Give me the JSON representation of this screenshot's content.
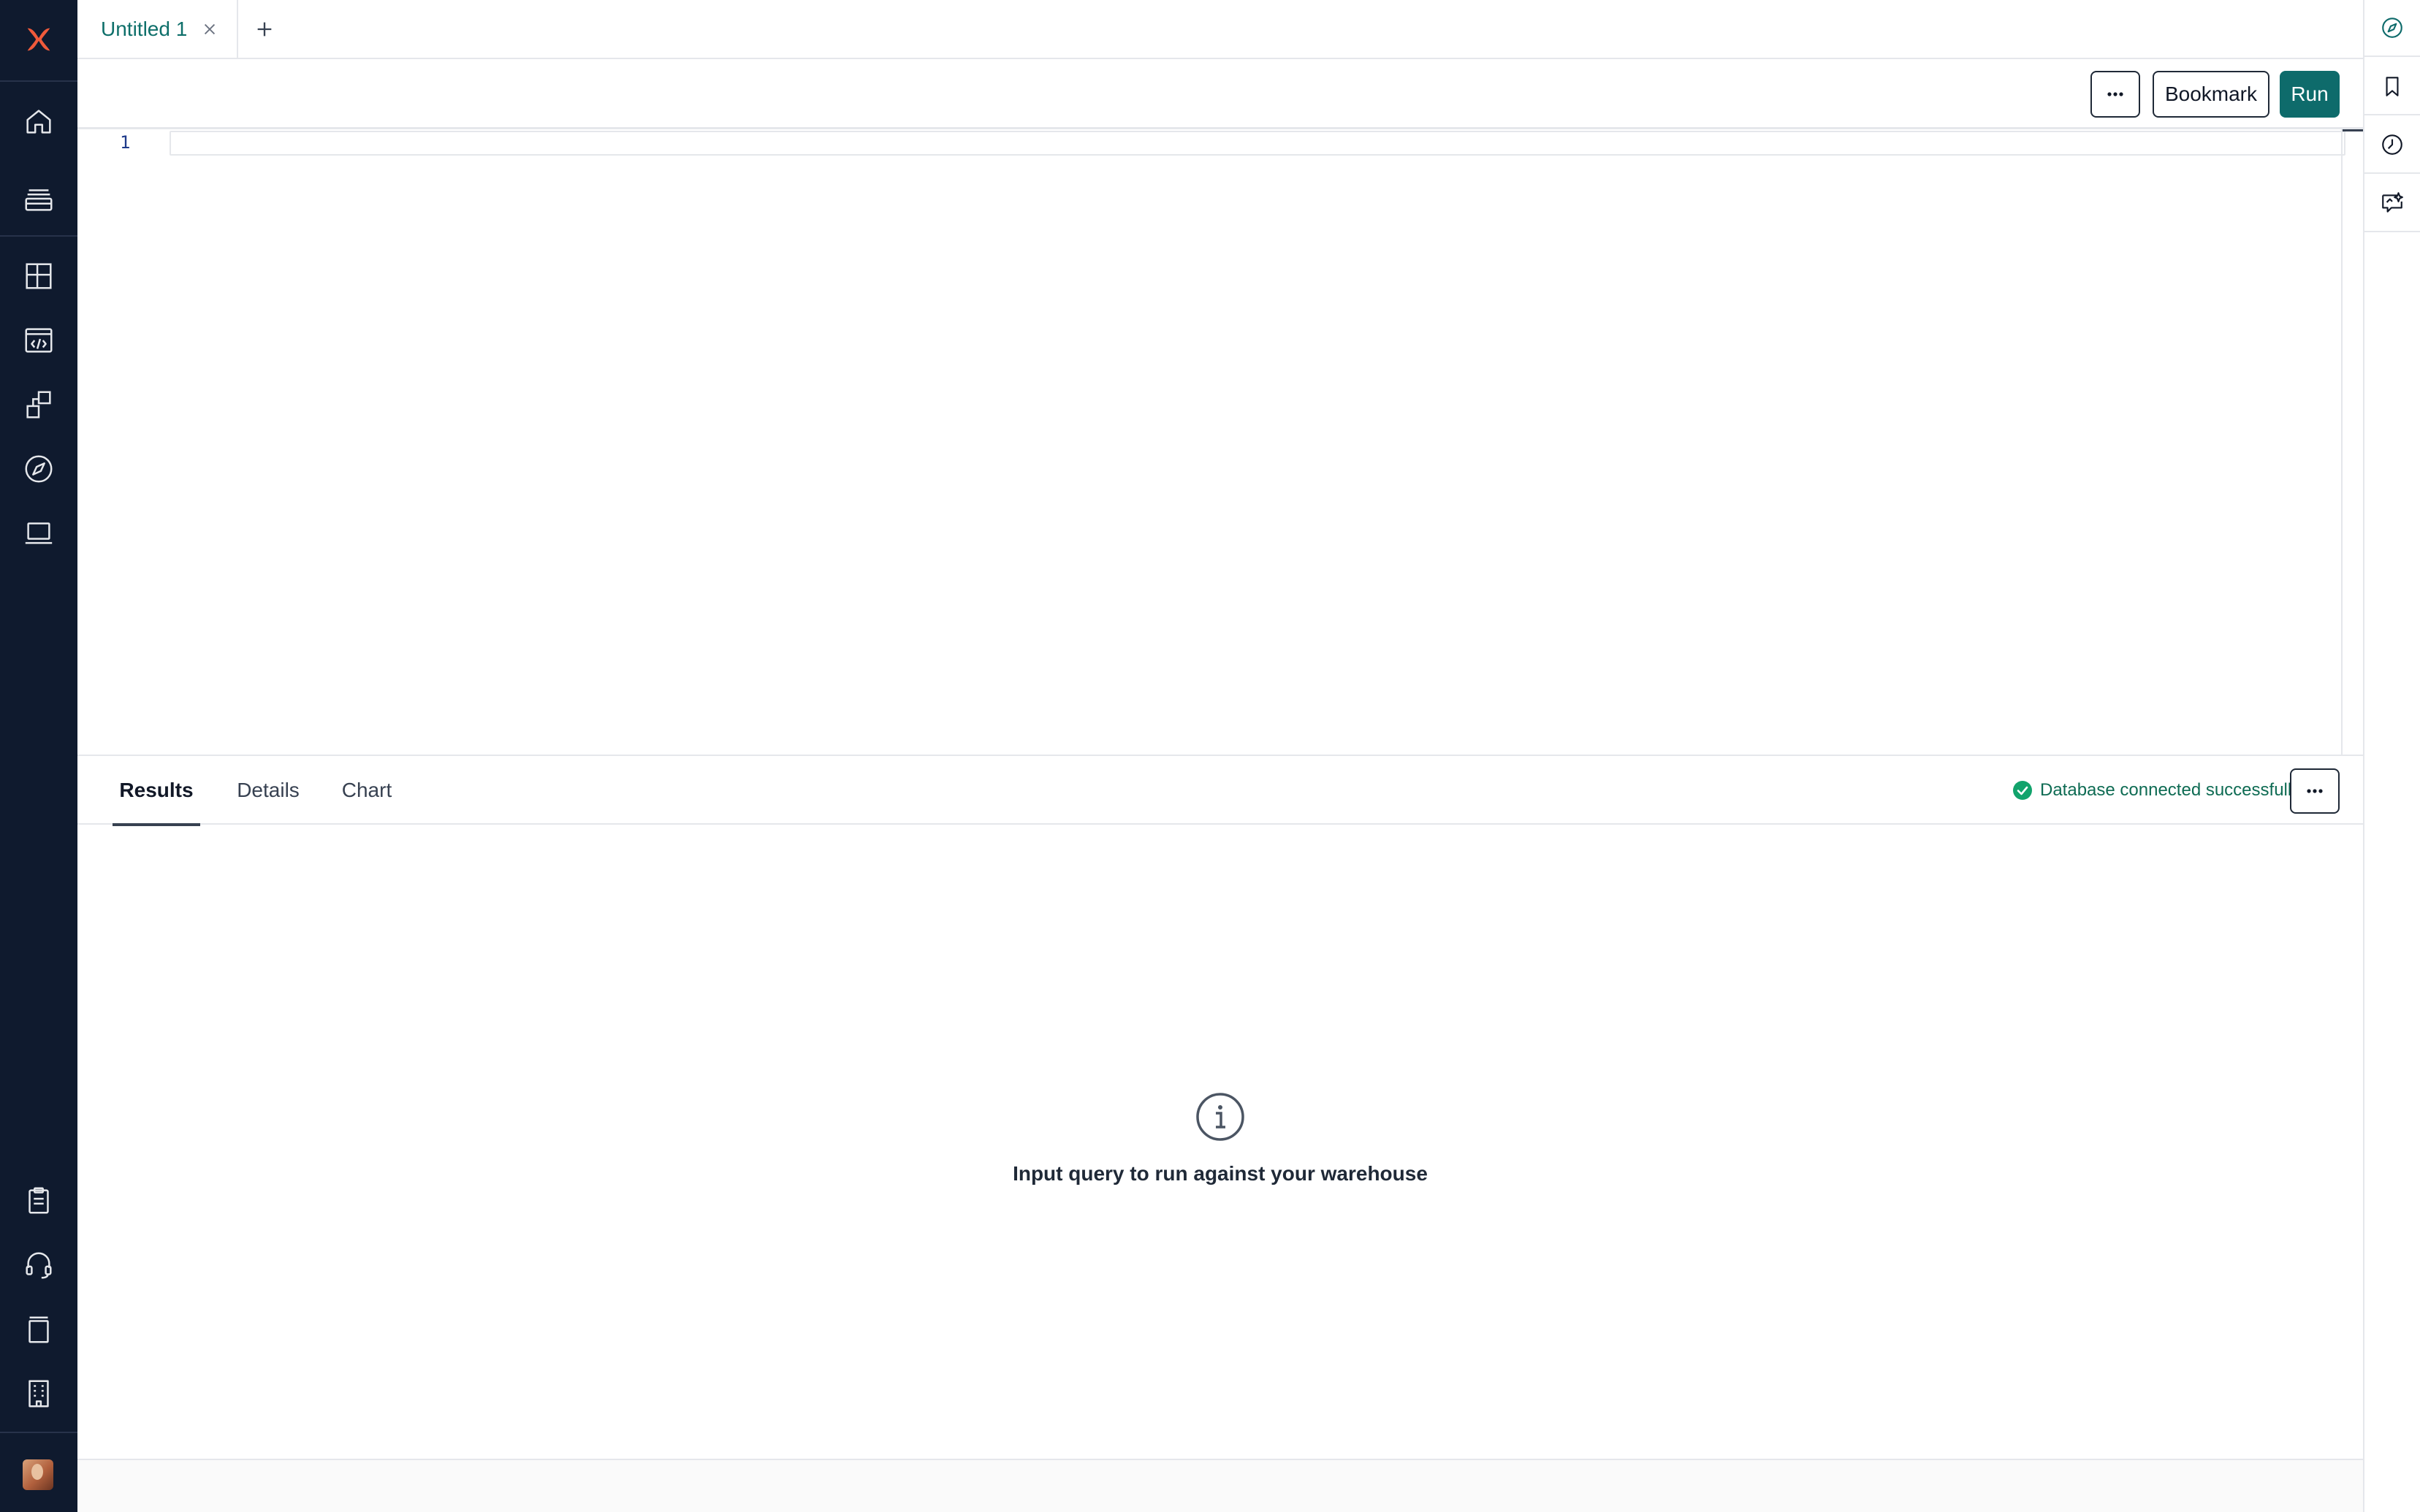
{
  "tabs": [
    {
      "label": "Untitled 1"
    }
  ],
  "toolbar": {
    "bookmark_label": "Bookmark",
    "run_label": "Run"
  },
  "editor": {
    "line_numbers": [
      "1"
    ]
  },
  "results": {
    "tabs": [
      "Results",
      "Details",
      "Chart"
    ],
    "active_tab": "Results",
    "status": "Database connected successfully",
    "empty_message": "Input query to run against your warehouse"
  },
  "colors": {
    "sidebar_bg": "#0f1a2e",
    "accent": "#0e6b6b",
    "logo": "#f05a3b",
    "success": "#12a36c"
  },
  "icons": {
    "left_nav_top": [
      "logo-icon",
      "home-icon",
      "database-icon"
    ],
    "left_nav_middle": [
      "dashboard-grid-icon",
      "code-browser-icon",
      "shapes-icon",
      "compass-icon",
      "laptop-icon"
    ],
    "left_nav_bottom": [
      "clipboard-icon",
      "headset-icon",
      "docs-icon",
      "building-icon"
    ],
    "right_rail": [
      "compass-icon",
      "bookmark-icon",
      "history-icon",
      "ai-assistant-icon"
    ]
  }
}
